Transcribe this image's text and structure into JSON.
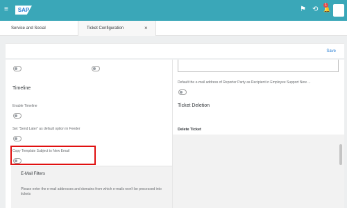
{
  "shell": {
    "logo": "SAP",
    "menu_icon": "≡",
    "feedback_icon": "⚑",
    "history_icon": "⟲",
    "bell_icon": "🔔",
    "notification_count": "1"
  },
  "tabs": [
    {
      "label": "Service and Social"
    },
    {
      "label": "Ticket Configuration",
      "close": "×"
    }
  ],
  "toolbar": {
    "save_label": "Save"
  },
  "left": {
    "timeline_heading": "Timeline",
    "enable_timeline": "Enable Timeline",
    "send_later": "Set \"Send Later\" as default option in Feeder",
    "copy_template": "Copy Template Subject to New Email",
    "email_filters_title": "E-Mail Filters",
    "email_filters_desc": "Please enter the e-mail addresses and domains from which e-mails won't be processed into tickets"
  },
  "right": {
    "default_email": "Default the e-mail address of Reporter Party as Recipient in Employee Support New ...",
    "ticket_deletion": "Ticket Deletion",
    "delete_ticket": "Delete Ticket"
  },
  "colors": {
    "shell": "#3aa7b8",
    "accent": "#2a7fd4",
    "highlight": "#e01010"
  }
}
